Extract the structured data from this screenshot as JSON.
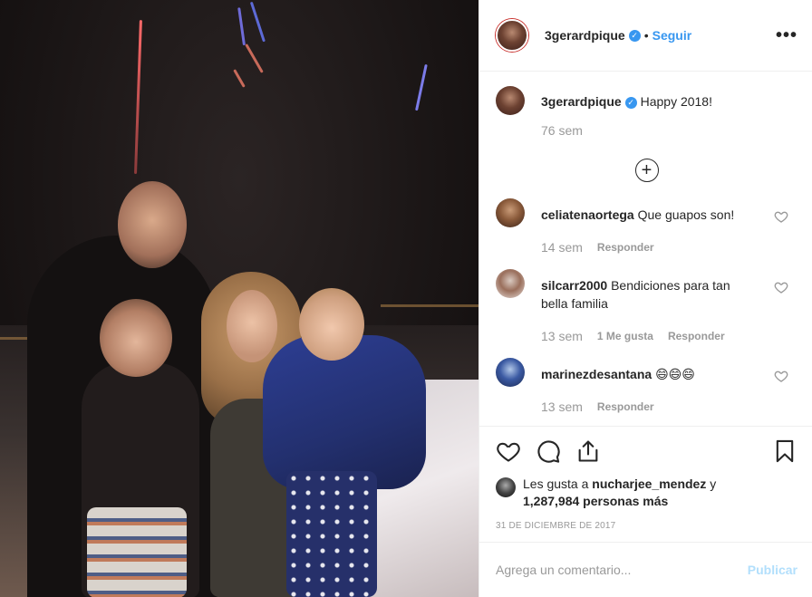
{
  "post": {
    "author": "3gerardpique",
    "follow_label": "Seguir",
    "separator": "•",
    "more_label": "•••",
    "caption_text": "Happy 2018!",
    "caption_time": "76 sem",
    "load_more_label": "+",
    "photo_description": "family-new-year-fireworks-photo"
  },
  "comments": [
    {
      "user": "celiatenaortega",
      "text": "Que guapos son!",
      "time": "14 sem",
      "likes": "",
      "reply": "Responder"
    },
    {
      "user": "silcarr2000",
      "text": "Bendiciones para tan bella familia",
      "time": "13 sem",
      "likes": "1 Me gusta",
      "reply": "Responder"
    },
    {
      "user": "marinezdesantana",
      "text": "😄😄😄",
      "time": "13 sem",
      "likes": "",
      "reply": "Responder"
    }
  ],
  "likes": {
    "prefix": "Les gusta a",
    "user": "nucharjee_mendez",
    "conjunction": "y",
    "others": "1,287,984 personas más"
  },
  "timestamp": "31 DE DICIEMBRE DE 2017",
  "add_comment": {
    "placeholder": "Agrega un comentario...",
    "publish_label": "Publicar"
  },
  "icons": [
    "verified-icon",
    "more-options-icon",
    "heart-icon",
    "comment-icon",
    "share-icon",
    "bookmark-icon",
    "add-comment-icon"
  ],
  "colors": {
    "accent": "#3897f0",
    "publish_disabled": "#b2dffc",
    "muted": "#999999",
    "text": "#262626"
  }
}
